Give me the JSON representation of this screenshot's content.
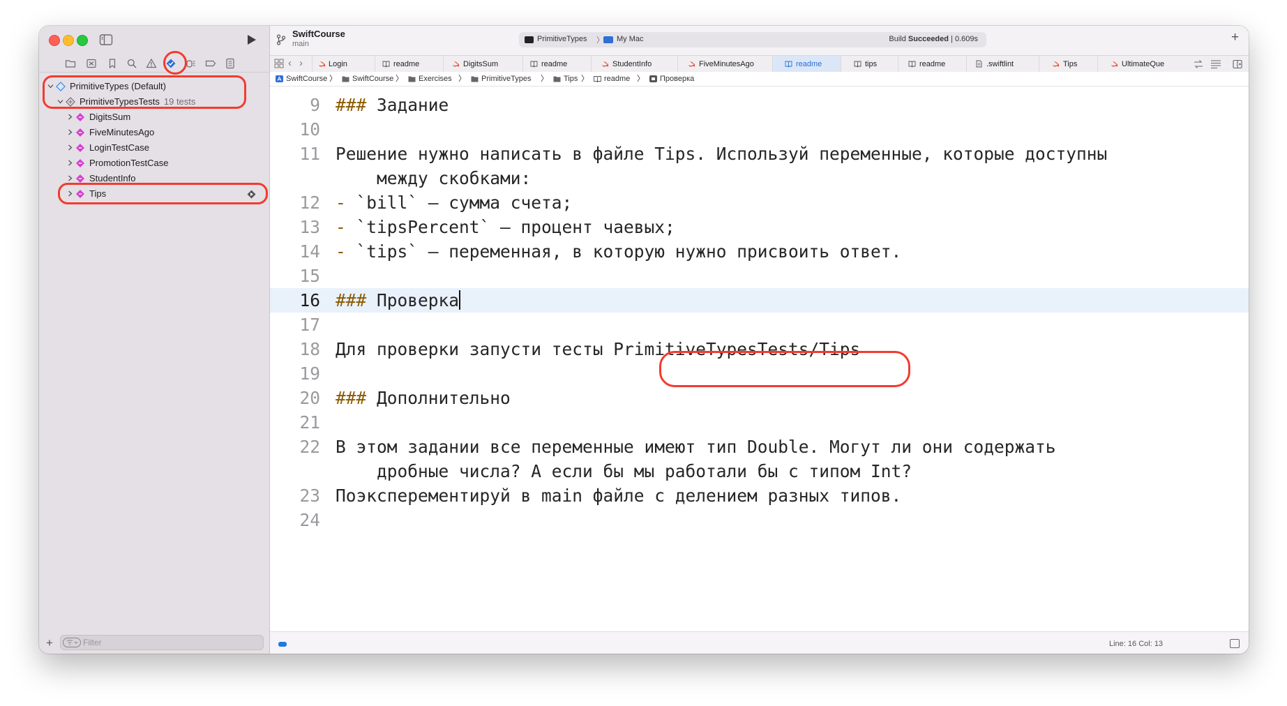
{
  "sidebar": {
    "tree": [
      {
        "label": "PrimitiveTypes (Default)",
        "count": ""
      },
      {
        "label": "PrimitiveTypesTests",
        "count": "19 tests"
      },
      {
        "label": "DigitsSum",
        "count": ""
      },
      {
        "label": "FiveMinutesAgo",
        "count": ""
      },
      {
        "label": "LoginTestCase",
        "count": ""
      },
      {
        "label": "PromotionTestCase",
        "count": ""
      },
      {
        "label": "StudentInfo",
        "count": ""
      },
      {
        "label": "Tips",
        "count": ""
      }
    ],
    "filter": {
      "placeholder": "Filter",
      "add": "+"
    }
  },
  "titlebar": {
    "project": "SwiftCourse",
    "branch": "main",
    "scheme": "PrimitiveTypes",
    "separator": "〉",
    "destination": "My Mac",
    "build_prefix": "Build ",
    "build_status": "Succeeded",
    "build_time": " | 0.609s",
    "add": "+"
  },
  "tabs": [
    {
      "label": "Login",
      "icon": "swift-icon"
    },
    {
      "label": "readme",
      "icon": "book-icon"
    },
    {
      "label": "DigitsSum",
      "icon": "swift-icon"
    },
    {
      "label": "readme",
      "icon": "book-icon"
    },
    {
      "label": "StudentInfo",
      "icon": "swift-icon"
    },
    {
      "label": "FiveMinutesAgo",
      "icon": "swift-icon"
    },
    {
      "label": "readme",
      "icon": "book-icon",
      "active": true
    },
    {
      "label": "tips",
      "icon": "book-icon"
    },
    {
      "label": "readme",
      "icon": "book-icon"
    },
    {
      "label": ".swiftlint",
      "icon": "doc-icon"
    },
    {
      "label": "Tips",
      "icon": "swift-icon"
    },
    {
      "label": "UltimateQue",
      "icon": "swift-icon"
    }
  ],
  "tab_nav": {
    "back": "‹",
    "forward": "›"
  },
  "breadcrumbs": [
    "SwiftCourse",
    "SwiftCourse",
    "Exercises",
    "PrimitiveTypes",
    "Tips",
    "readme",
    "Проверка"
  ],
  "crumb_sep": "〉",
  "code": [
    {
      "n": "9",
      "h": "### ",
      "t": "Задание"
    },
    {
      "n": "10",
      "t": ""
    },
    {
      "n": "11",
      "t": "Решение нужно написать в файле Tips. Используй переменные, которые доступны"
    },
    {
      "n": "",
      "t": "    между скобками:"
    },
    {
      "n": "12",
      "d": "- ",
      "t": "`bill` — сумма счета;"
    },
    {
      "n": "13",
      "d": "- ",
      "t": "`tipsPercent` — процент чаевых;"
    },
    {
      "n": "14",
      "d": "- ",
      "t": "`tips` — переменная, в которую нужно присвоить ответ."
    },
    {
      "n": "15",
      "t": ""
    },
    {
      "n": "16",
      "h": "### ",
      "t": "Проверка",
      "cur": true
    },
    {
      "n": "17",
      "t": ""
    },
    {
      "n": "18",
      "t": "Для проверки запусти тесты PrimitiveTypesTests/Tips"
    },
    {
      "n": "19",
      "t": ""
    },
    {
      "n": "20",
      "h": "### ",
      "t": "Дополнительно"
    },
    {
      "n": "21",
      "t": ""
    },
    {
      "n": "22",
      "t": "В этом задании все переменные имеют тип Double. Могут ли они содержать"
    },
    {
      "n": "",
      "t": "    дробные числа? А если бы мы работали бы с типом Int?"
    },
    {
      "n": "23",
      "t": "Поэксперементируй в main файле с делением разных типов."
    },
    {
      "n": "24",
      "t": ""
    }
  ],
  "status": {
    "position": "Line: 16  Col: 13"
  },
  "colors": {
    "accent": "#2a6fd6",
    "annotation": "#f23b2f",
    "test_diamond": "#d63fd0"
  }
}
